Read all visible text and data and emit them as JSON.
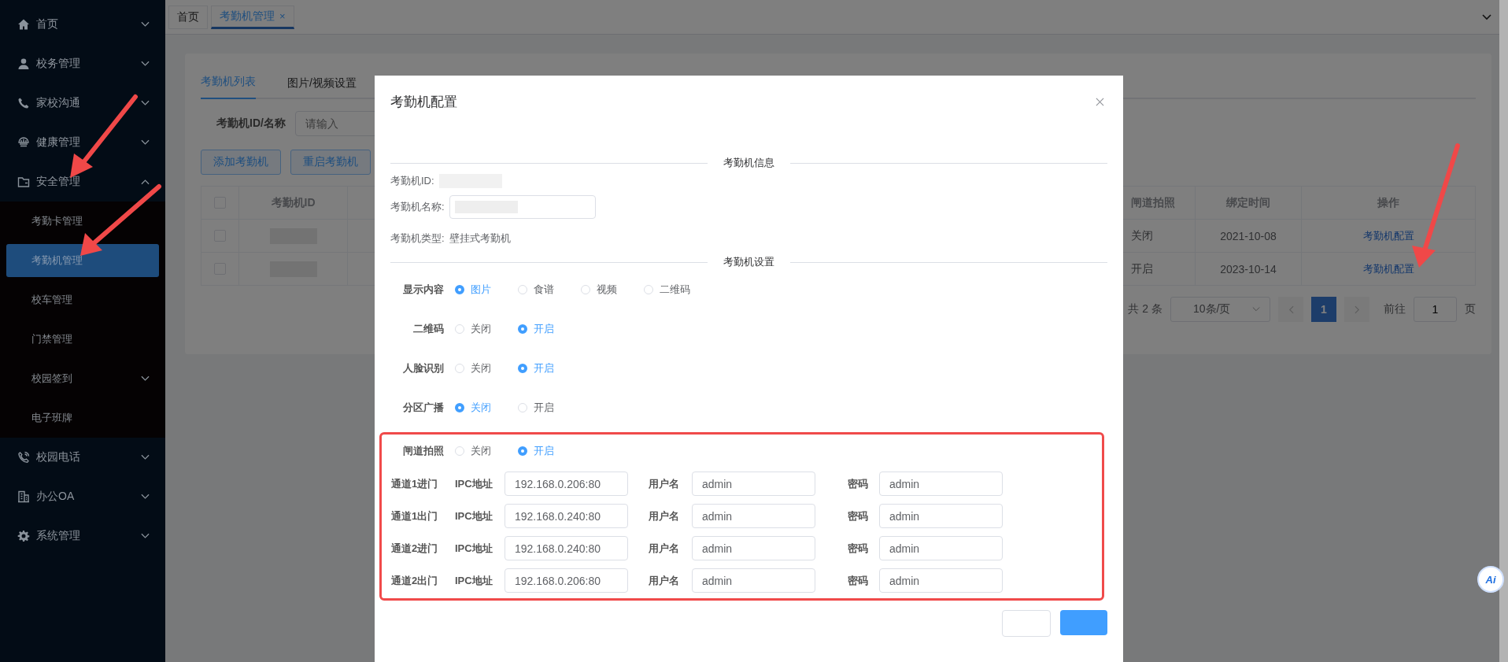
{
  "sidebar": {
    "items": [
      {
        "label": "首页",
        "expanded": false
      },
      {
        "label": "校务管理",
        "expanded": false
      },
      {
        "label": "家校沟通",
        "expanded": false
      },
      {
        "label": "健康管理",
        "expanded": false
      },
      {
        "label": "安全管理",
        "expanded": true,
        "children": [
          {
            "label": "考勤卡管理",
            "selected": false,
            "expandable": false
          },
          {
            "label": "考勤机管理",
            "selected": true,
            "expandable": false
          },
          {
            "label": "校车管理",
            "selected": false,
            "expandable": false
          },
          {
            "label": "门禁管理",
            "selected": false,
            "expandable": false
          },
          {
            "label": "校园签到",
            "selected": false,
            "expandable": true
          },
          {
            "label": "电子班牌",
            "selected": false,
            "expandable": false
          }
        ]
      },
      {
        "label": "校园电话",
        "expanded": false
      },
      {
        "label": "办公OA",
        "expanded": false
      },
      {
        "label": "系统管理",
        "expanded": false
      }
    ]
  },
  "page_tabs": [
    {
      "label": "首页",
      "selected": false,
      "closable": false
    },
    {
      "label": "考勤机管理",
      "selected": true,
      "closable": true,
      "close": "×"
    }
  ],
  "content_tabs": [
    {
      "label": "考勤机列表",
      "selected": true
    },
    {
      "label": "图片/视频设置",
      "selected": false
    }
  ],
  "search": {
    "label": "考勤机ID/名称",
    "placeholder": "请输入"
  },
  "buttons": [
    "添加考勤机",
    "重启考勤机"
  ],
  "table": {
    "header_checked": false,
    "columns": [
      "考勤机ID",
      "闸道拍照",
      "绑定时间",
      "操作"
    ],
    "rows": [
      {
        "checked": false,
        "gate_photo": "关闭",
        "bind_time": "2021-10-08",
        "action": "考勤机配置"
      },
      {
        "checked": false,
        "gate_photo": "开启",
        "bind_time": "2023-10-14",
        "action": "考勤机配置"
      }
    ]
  },
  "pagination": {
    "total": "共 2 条",
    "page_size": "10条/页",
    "pages": [
      {
        "label": "1",
        "selected": true
      }
    ],
    "goto_label": "前往",
    "goto_value": "1",
    "goto_suffix": "页"
  },
  "dialog": {
    "title": "考勤机配置",
    "info_heading": "考勤机信息",
    "id_label": "考勤机ID:",
    "name_label": "考勤机名称:",
    "type_label": "考勤机类型:",
    "type_value": "壁挂式考勤机",
    "settings_heading": "考勤机设置",
    "settings": [
      {
        "label": "显示内容",
        "options": [
          {
            "label": "图片",
            "selected": true
          },
          {
            "label": "食谱",
            "selected": false
          },
          {
            "label": "视频",
            "selected": false
          },
          {
            "label": "二维码",
            "selected": false
          }
        ]
      },
      {
        "label": "二维码",
        "options": [
          {
            "label": "关闭",
            "selected": false
          },
          {
            "label": "开启",
            "selected": true
          }
        ]
      },
      {
        "label": "人脸识别",
        "options": [
          {
            "label": "关闭",
            "selected": false
          },
          {
            "label": "开启",
            "selected": true
          }
        ]
      },
      {
        "label": "分区广播",
        "options": [
          {
            "label": "关闭",
            "selected": true
          },
          {
            "label": "开启",
            "selected": false
          }
        ]
      }
    ],
    "gate_setting": {
      "label": "闸道拍照",
      "options": [
        {
          "label": "关闭",
          "selected": false
        },
        {
          "label": "开启",
          "selected": true
        }
      ]
    },
    "channels": [
      {
        "name": "通道1进门",
        "ipc_label": "IPC地址",
        "ipc": "192.168.0.206:80",
        "user_label": "用户名",
        "user": "admin",
        "password_label": "密码",
        "password": "admin"
      },
      {
        "name": "通道1出门",
        "ipc_label": "IPC地址",
        "ipc": "192.168.0.240:80",
        "user_label": "用户名",
        "user": "admin",
        "password_label": "密码",
        "password": "admin"
      },
      {
        "name": "通道2进门",
        "ipc_label": "IPC地址",
        "ipc": "192.168.0.240:80",
        "user_label": "用户名",
        "user": "admin",
        "password_label": "密码",
        "password": "admin"
      },
      {
        "name": "通道2出门",
        "ipc_label": "IPC地址",
        "ipc": "192.168.0.206:80",
        "user_label": "用户名",
        "user": "admin",
        "password_label": "密码",
        "password": "admin"
      }
    ]
  },
  "assistant_button": {
    "label": "Ai"
  }
}
